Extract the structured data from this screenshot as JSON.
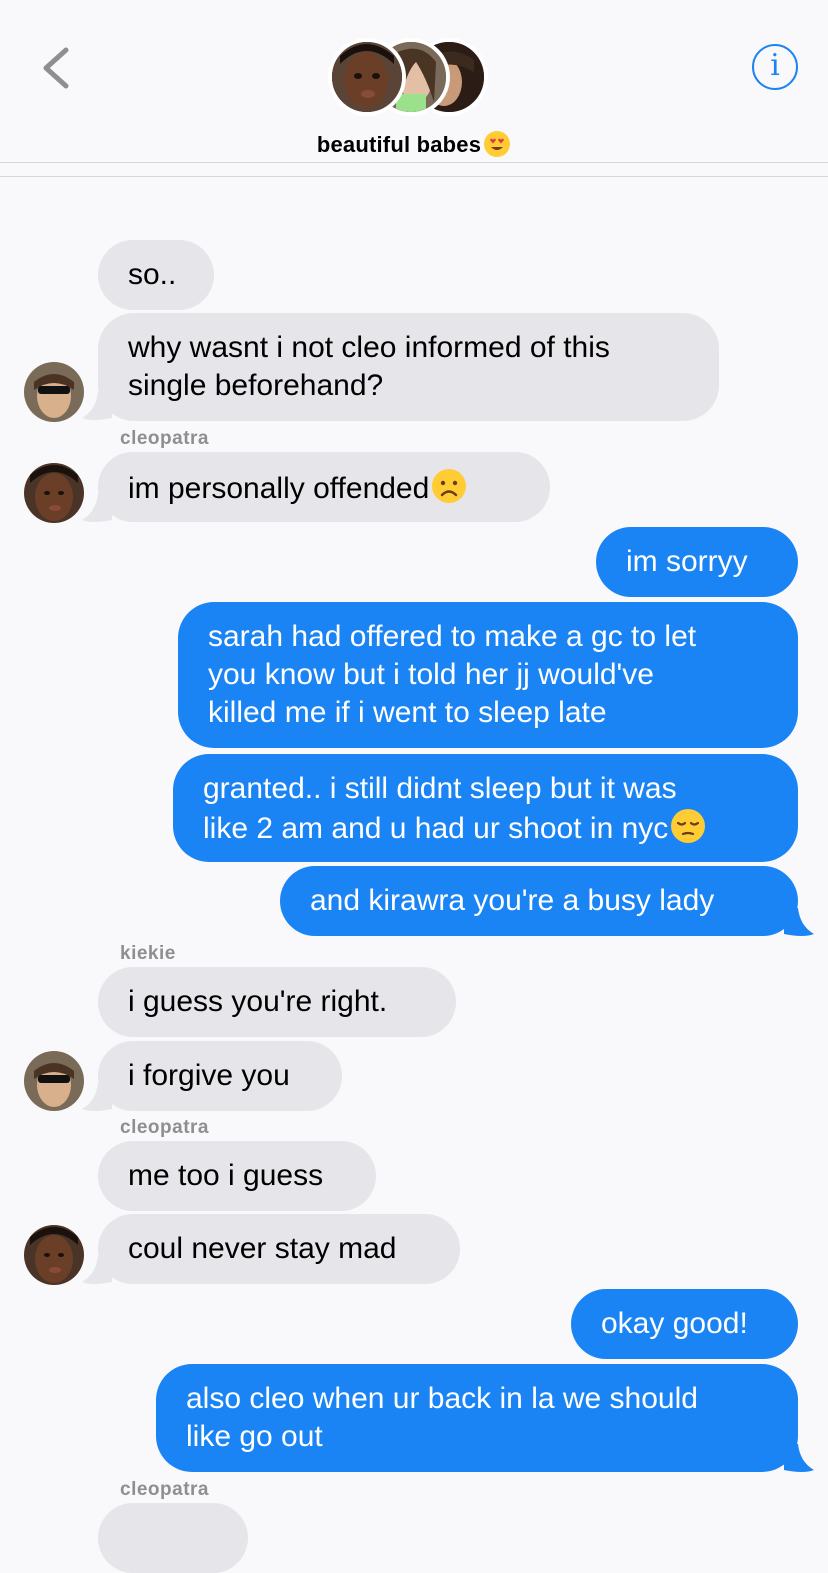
{
  "header": {
    "group_name": "beautiful babes",
    "title_emoji": "heart-eyes-emoji",
    "info_glyph": "i"
  },
  "colors": {
    "accent": "#1b84f5",
    "incoming_bubble": "#e5e5ea",
    "outgoing_bubble": "#1b84f5",
    "background": "#f9f9fb",
    "sender_label": "#8e8e93"
  },
  "messages": [
    {
      "dir": "in",
      "text": "so.."
    },
    {
      "dir": "in",
      "text": "why wasnt i not cleo informed of this single beforehand?"
    },
    {
      "dir": "in",
      "sender": "cleopatra",
      "text": "im personally offended",
      "emoji": "frowning-face-emoji"
    },
    {
      "dir": "out",
      "text": "im sorryy"
    },
    {
      "dir": "out",
      "text": "sarah had offered to make a gc to let you know but i told her jj would've killed me if i went to sleep late"
    },
    {
      "dir": "out",
      "text": "granted.. i still didnt sleep but it was like 2 am and u had ur shoot in nyc",
      "emoji": "pensive-face-emoji"
    },
    {
      "dir": "out",
      "text": "and kirawra you're a busy lady"
    },
    {
      "dir": "in",
      "sender": "kiekie",
      "text": "i guess you're right."
    },
    {
      "dir": "in",
      "text": "i forgive you"
    },
    {
      "dir": "in",
      "sender": "cleopatra",
      "text": "me too i guess"
    },
    {
      "dir": "in",
      "text": "coul never stay mad"
    },
    {
      "dir": "out",
      "text": "okay good!"
    },
    {
      "dir": "out",
      "text": "also cleo when ur back in la we should like go out"
    },
    {
      "dir": "in",
      "sender": "cleopatra",
      "text": ""
    }
  ],
  "sender_labels": {
    "cleopatra_1": "cleopatra",
    "kiekie": "kiekie",
    "cleopatra_2": "cleopatra",
    "cleopatra_3": "cleopatra"
  },
  "bubble_text": {
    "m1": "so..",
    "m2a": "why wasnt i not cleo informed of this",
    "m2b": "single beforehand?",
    "m3": "im personally offended",
    "m4": "im sorryy",
    "m5a": "sarah had offered to make a gc to let",
    "m5b": "you know but i told her jj would've",
    "m5c": "killed me if i went to sleep late",
    "m6a": "granted.. i still didnt sleep but it was",
    "m6b": "like 2 am and u had ur shoot in nyc",
    "m7": "and kirawra you're a busy lady",
    "m8": "i guess you're right.",
    "m9": "i forgive you",
    "m10": "me too i guess",
    "m11": "coul never stay mad",
    "m12": "okay good!",
    "m13a": "also cleo when ur back in la we should",
    "m13b": "like go out"
  }
}
